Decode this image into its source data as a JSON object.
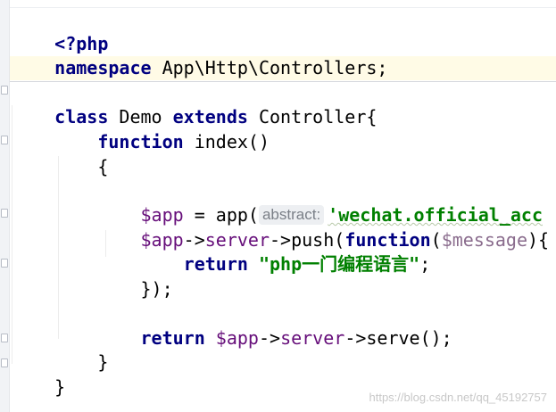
{
  "code": {
    "line1": {
      "php_open": "<?php"
    },
    "line2": {
      "kw_namespace": "namespace",
      "ns_value": " App\\Http\\Controllers;"
    },
    "line4": {
      "kw_class": "class",
      "class_name": " Demo ",
      "kw_extends": "extends",
      "parent": " Controller{"
    },
    "line5": {
      "indent": "    ",
      "kw_function": "function",
      "fn_sig": " index()"
    },
    "line6": {
      "brace": "    {"
    },
    "line8": {
      "indent": "        ",
      "var_app": "$app",
      "assign": " = app(",
      "hint": "abstract:",
      "string_arg": "'wechat.official_acc"
    },
    "line9": {
      "indent": "        ",
      "var_app": "$app",
      "arrow1": "->",
      "prop_server": "server",
      "arrow_push": "->push(",
      "kw_function": "function",
      "paren_open": "(",
      "var_message": "$message",
      "paren_close": "){"
    },
    "line10": {
      "indent": "            ",
      "kw_return": "return",
      "space": " ",
      "string": "\"php一门编程语言\"",
      "semi": ";"
    },
    "line11": {
      "indent": "        ",
      "close": "});"
    },
    "line13": {
      "indent": "        ",
      "kw_return": "return",
      "space": " ",
      "var_app": "$app",
      "arrow1": "->",
      "prop_server": "server",
      "tail": "->serve();"
    },
    "line14": {
      "brace": "    }"
    },
    "line15": {
      "brace": "}"
    }
  },
  "watermark": "https://blog.csdn.net/qq_45192757",
  "colors": {
    "keyword": "#000080",
    "variable": "#660e7a",
    "string": "#008000",
    "current_line_bg": "#fffbe6",
    "gutter_bg": "#f1f3f6",
    "hint_bg": "#edeff2"
  }
}
